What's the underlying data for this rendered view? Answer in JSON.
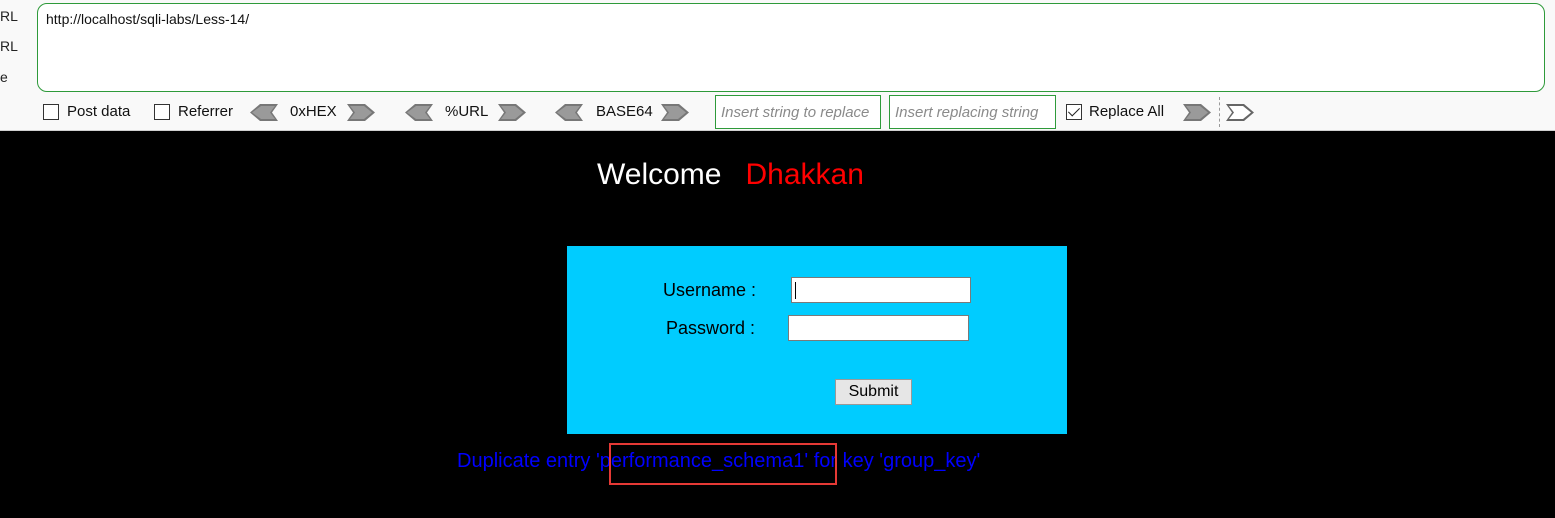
{
  "hackbar": {
    "side_labels": [
      "RL",
      "RL",
      "e"
    ],
    "url_value": "http://localhost/sqli-labs/Less-14/",
    "post_data_label": "Post data",
    "post_data_checked": false,
    "referrer_label": "Referrer",
    "referrer_checked": false,
    "hex_label": "0xHEX",
    "url_encode_label": "%URL",
    "base64_label": "BASE64",
    "replace_find_placeholder": "Insert string to replace",
    "replace_with_placeholder": "Insert replacing string",
    "replace_all_label": "Replace All",
    "replace_all_checked": true
  },
  "page": {
    "welcome_text": "Welcome",
    "welcome_name": "Dhakkan",
    "username_label": "Username :",
    "password_label": "Password :",
    "username_value": "",
    "password_value": "",
    "submit_label": "Submit",
    "error_message": "Duplicate entry 'performance_schema1' for key 'group_key'"
  },
  "colors": {
    "background": "#000000",
    "login_box": "#00ccff",
    "welcome_name": "#ff0000",
    "error_text": "#0000ff",
    "highlight_box": "#e53935",
    "hackbar_border": "#2e9a3a"
  }
}
